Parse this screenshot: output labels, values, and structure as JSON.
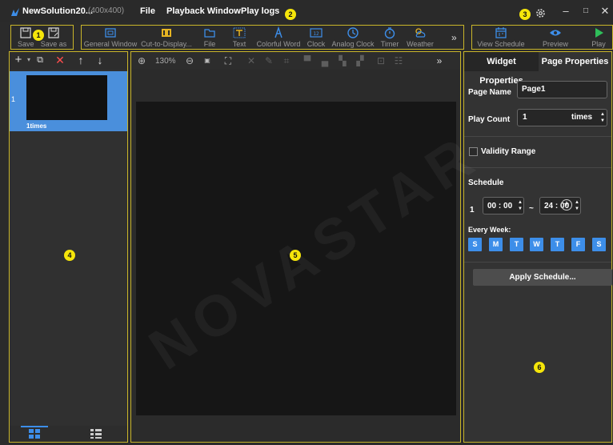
{
  "window": {
    "title": "NewSolution20...",
    "size": "(400x400)",
    "menu": [
      "File",
      "Playback Window",
      "Play logs"
    ]
  },
  "badges": [
    "1",
    "2",
    "3",
    "4",
    "5",
    "6"
  ],
  "toolbar": {
    "save": "Save",
    "save_as": "Save as",
    "general_window": "General Window",
    "cut_to_display": "Cut-to-Display...",
    "file": "File",
    "text": "Text",
    "colorful_word": "Colorful Word",
    "clock": "Clock",
    "analog_clock": "Analog Clock",
    "timer": "Timer",
    "weather": "Weather",
    "more": "»",
    "view_schedule": "View Schedule",
    "preview": "Preview",
    "play": "Play"
  },
  "page_list": {
    "items": [
      {
        "index": "1",
        "times": "1times"
      }
    ]
  },
  "canvas_tools": {
    "zoom": "130%",
    "more": "»"
  },
  "properties": {
    "tab_widget": "Widget Properties",
    "tab_page": "Page Properties",
    "page_name_label": "Page Name",
    "page_name_value": "Page1",
    "play_count_label": "Play Count",
    "play_count_value": "1",
    "play_count_unit": "times",
    "validity_label": "Validity Range",
    "schedule_label": "Schedule",
    "schedule_index": "1",
    "start_time": "00 : 00",
    "range_sep": "~",
    "end_time": "24 : 00",
    "every_week_label": "Every Week:",
    "days": [
      "S",
      "M",
      "T",
      "W",
      "T",
      "F",
      "S"
    ],
    "apply_label": "Apply Schedule..."
  },
  "watermark": "NOVASTAR",
  "colors": {
    "accent": "#3d8ee9",
    "annotation": "#f5e50a",
    "annotation_border": "#c9b52a",
    "play": "#2fbf5a"
  }
}
